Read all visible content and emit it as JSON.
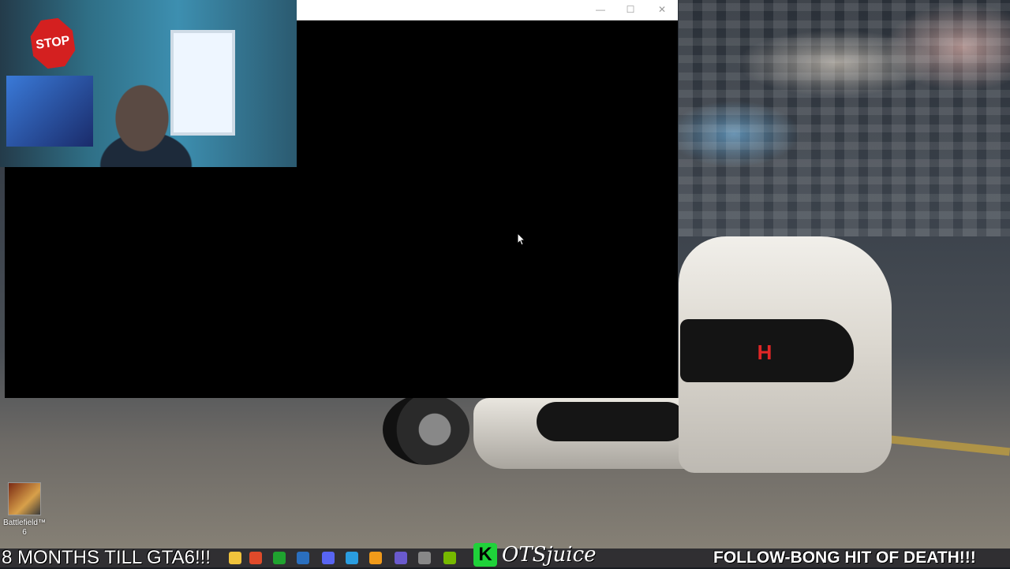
{
  "app_window": {
    "title": "",
    "controls": {
      "minimize": "—",
      "maximize": "☐",
      "close": "✕"
    }
  },
  "webcam": {
    "stop_sign_text": "STOP"
  },
  "desktop_icons": [
    {
      "label": "Battlefield™ 6",
      "icon": "battlefield-icon"
    }
  ],
  "overlays": {
    "ticker_left": "8 MONTHS TILL GTA6!!!",
    "ticker_right": "FOLLOW-BONG HIT OF DEATH!!!",
    "brand_badge": "K",
    "brand_name": "OTSjuice"
  },
  "taskbar_icons": [
    {
      "name": "file-explorer-icon",
      "color": "#f0c33c"
    },
    {
      "name": "chrome-icon",
      "color": "#e04a2a"
    },
    {
      "name": "xbox-icon",
      "color": "#1fa32f"
    },
    {
      "name": "steam-icon",
      "color": "#2a6fbf"
    },
    {
      "name": "discord-icon",
      "color": "#5865f2"
    },
    {
      "name": "skype-icon",
      "color": "#2a9de0"
    },
    {
      "name": "aegis-icon",
      "color": "#f09a1a"
    },
    {
      "name": "app-icon",
      "color": "#6a5acd"
    },
    {
      "name": "obs-icon",
      "color": "#888888"
    },
    {
      "name": "nvidia-icon",
      "color": "#76b900"
    }
  ],
  "car_badge": "H"
}
